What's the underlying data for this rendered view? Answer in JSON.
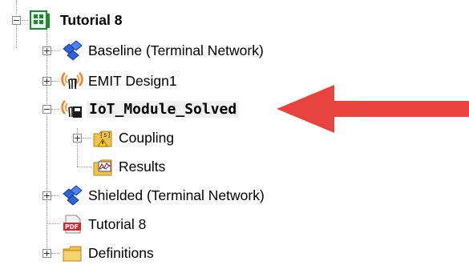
{
  "tree": {
    "root": {
      "label": "Tutorial 8",
      "icon": "project-icon"
    },
    "items": [
      {
        "label": "Baseline (Terminal Network)",
        "icon": "network-icon"
      },
      {
        "label": "EMIT Design1",
        "icon": "emit-design-icon"
      },
      {
        "label": "IoT_Module_Solved",
        "icon": "emit-design-selected-icon"
      },
      {
        "label": "Coupling",
        "icon": "coupling-folder-icon"
      },
      {
        "label": "Results",
        "icon": "results-folder-icon"
      },
      {
        "label": "Shielded (Terminal Network)",
        "icon": "network-icon"
      },
      {
        "label": "Tutorial 8",
        "icon": "pdf-icon"
      },
      {
        "label": "Definitions",
        "icon": "folder-icon"
      }
    ]
  },
  "colors": {
    "arrow": "#e8433f",
    "selection": "#f0f0f0"
  }
}
